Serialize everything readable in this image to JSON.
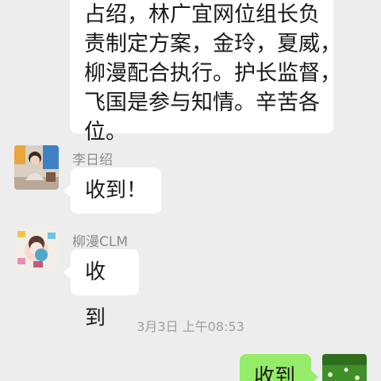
{
  "messages": {
    "first": {
      "lines": [
        "占绍，林广宜网位组长负",
        "责制定方案，金玲，夏威，",
        "柳漫配合执行。护长监督，",
        "飞国是参与知情。辛苦各",
        "位。"
      ]
    },
    "second": {
      "sender": "李日绍",
      "text": "收到！"
    },
    "third": {
      "sender": "柳漫CLM",
      "text": "收到"
    },
    "timestamp": "3月3日 上午08:53",
    "outgoing": {
      "text": "收到"
    }
  },
  "colors": {
    "background": "#ededed",
    "incoming_bubble": "#ffffff",
    "outgoing_bubble": "#95ec69",
    "sender_text": "#8c8c8c"
  }
}
